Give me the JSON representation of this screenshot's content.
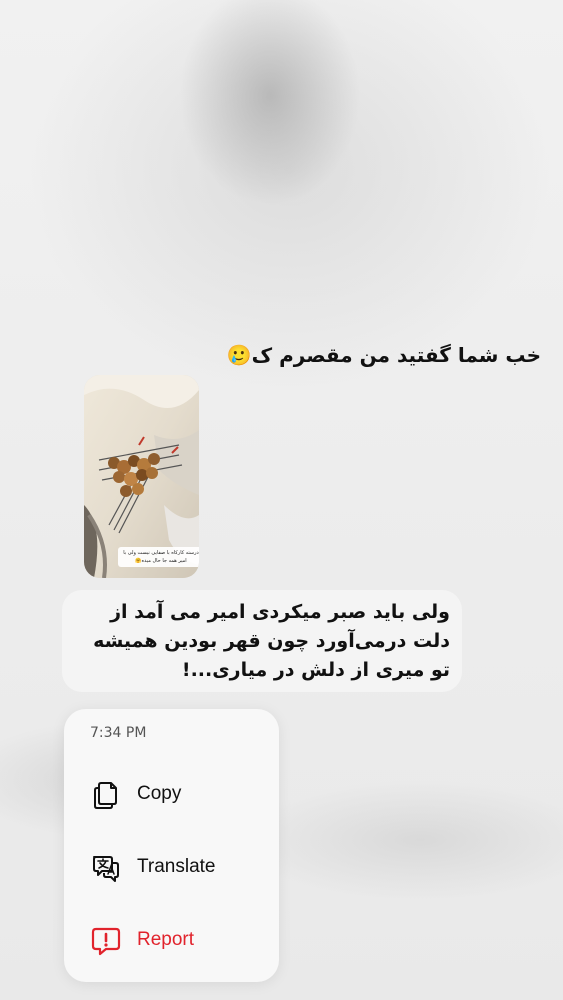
{
  "conversation": {
    "incoming_message": "خب شما گفتید من مقصرم ک🥲",
    "story_reply": {
      "caption": "درسته کارکاه با صفایی نیست ولی با امیر همه جا حال میده🤗",
      "reply_text": "ولی باید صبر میکردی امیر می آمد از دلت درمی‌آورد چون قهر بودین همیشه تو میری از دلش در میاری...!"
    }
  },
  "context_menu": {
    "timestamp": "7:34 PM",
    "items": [
      {
        "label": "Copy",
        "icon": "copy-icon",
        "color": "#111111"
      },
      {
        "label": "Translate",
        "icon": "translate-icon",
        "color": "#111111"
      },
      {
        "label": "Report",
        "icon": "report-icon",
        "color": "#e1232c"
      }
    ]
  },
  "colors": {
    "accent_danger": "#e1232c",
    "menu_background": "#f8f8f8",
    "text": "#111111"
  }
}
